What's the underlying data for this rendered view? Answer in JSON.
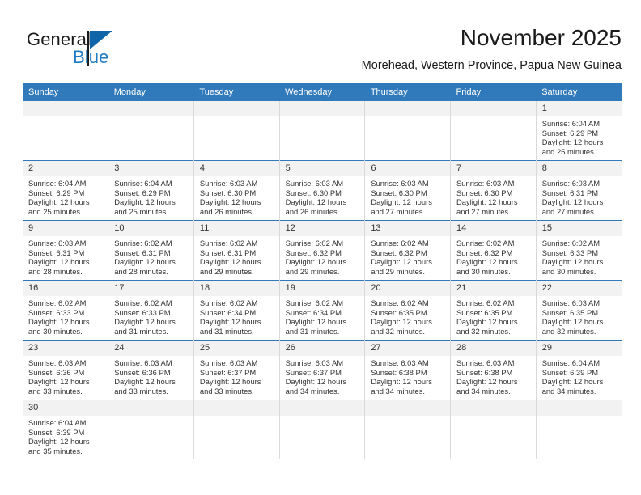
{
  "brand": {
    "name_primary": "General",
    "name_secondary": "Blue",
    "logo_icon": "blue-flag-triangle-icon",
    "primary_color": "#1a1a1a",
    "secondary_color": "#1f7bc1"
  },
  "header": {
    "title": "November 2025",
    "subtitle": "Morehead, Western Province, Papua New Guinea"
  },
  "theme": {
    "header_row_bg": "#3079ba",
    "header_row_text": "#ffffff",
    "daynum_bg": "#f2f2f2",
    "cell_bg": "#ffffff",
    "week_divider": "#3079ba",
    "column_divider": "#d9d9d9",
    "text_color": "#333333"
  },
  "weekdays": [
    "Sunday",
    "Monday",
    "Tuesday",
    "Wednesday",
    "Thursday",
    "Friday",
    "Saturday"
  ],
  "labels": {
    "sunrise_prefix": "Sunrise:",
    "sunset_prefix": "Sunset:",
    "daylight_prefix": "Daylight:"
  },
  "weeks": [
    [
      {
        "blank": true
      },
      {
        "blank": true
      },
      {
        "blank": true
      },
      {
        "blank": true
      },
      {
        "blank": true
      },
      {
        "blank": true
      },
      {
        "day": "1",
        "sunrise": "Sunrise: 6:04 AM",
        "sunset": "Sunset: 6:29 PM",
        "daylight_l1": "Daylight: 12 hours",
        "daylight_l2": "and 25 minutes."
      }
    ],
    [
      {
        "day": "2",
        "sunrise": "Sunrise: 6:04 AM",
        "sunset": "Sunset: 6:29 PM",
        "daylight_l1": "Daylight: 12 hours",
        "daylight_l2": "and 25 minutes."
      },
      {
        "day": "3",
        "sunrise": "Sunrise: 6:04 AM",
        "sunset": "Sunset: 6:29 PM",
        "daylight_l1": "Daylight: 12 hours",
        "daylight_l2": "and 25 minutes."
      },
      {
        "day": "4",
        "sunrise": "Sunrise: 6:03 AM",
        "sunset": "Sunset: 6:30 PM",
        "daylight_l1": "Daylight: 12 hours",
        "daylight_l2": "and 26 minutes."
      },
      {
        "day": "5",
        "sunrise": "Sunrise: 6:03 AM",
        "sunset": "Sunset: 6:30 PM",
        "daylight_l1": "Daylight: 12 hours",
        "daylight_l2": "and 26 minutes."
      },
      {
        "day": "6",
        "sunrise": "Sunrise: 6:03 AM",
        "sunset": "Sunset: 6:30 PM",
        "daylight_l1": "Daylight: 12 hours",
        "daylight_l2": "and 27 minutes."
      },
      {
        "day": "7",
        "sunrise": "Sunrise: 6:03 AM",
        "sunset": "Sunset: 6:30 PM",
        "daylight_l1": "Daylight: 12 hours",
        "daylight_l2": "and 27 minutes."
      },
      {
        "day": "8",
        "sunrise": "Sunrise: 6:03 AM",
        "sunset": "Sunset: 6:31 PM",
        "daylight_l1": "Daylight: 12 hours",
        "daylight_l2": "and 27 minutes."
      }
    ],
    [
      {
        "day": "9",
        "sunrise": "Sunrise: 6:03 AM",
        "sunset": "Sunset: 6:31 PM",
        "daylight_l1": "Daylight: 12 hours",
        "daylight_l2": "and 28 minutes."
      },
      {
        "day": "10",
        "sunrise": "Sunrise: 6:02 AM",
        "sunset": "Sunset: 6:31 PM",
        "daylight_l1": "Daylight: 12 hours",
        "daylight_l2": "and 28 minutes."
      },
      {
        "day": "11",
        "sunrise": "Sunrise: 6:02 AM",
        "sunset": "Sunset: 6:31 PM",
        "daylight_l1": "Daylight: 12 hours",
        "daylight_l2": "and 29 minutes."
      },
      {
        "day": "12",
        "sunrise": "Sunrise: 6:02 AM",
        "sunset": "Sunset: 6:32 PM",
        "daylight_l1": "Daylight: 12 hours",
        "daylight_l2": "and 29 minutes."
      },
      {
        "day": "13",
        "sunrise": "Sunrise: 6:02 AM",
        "sunset": "Sunset: 6:32 PM",
        "daylight_l1": "Daylight: 12 hours",
        "daylight_l2": "and 29 minutes."
      },
      {
        "day": "14",
        "sunrise": "Sunrise: 6:02 AM",
        "sunset": "Sunset: 6:32 PM",
        "daylight_l1": "Daylight: 12 hours",
        "daylight_l2": "and 30 minutes."
      },
      {
        "day": "15",
        "sunrise": "Sunrise: 6:02 AM",
        "sunset": "Sunset: 6:33 PM",
        "daylight_l1": "Daylight: 12 hours",
        "daylight_l2": "and 30 minutes."
      }
    ],
    [
      {
        "day": "16",
        "sunrise": "Sunrise: 6:02 AM",
        "sunset": "Sunset: 6:33 PM",
        "daylight_l1": "Daylight: 12 hours",
        "daylight_l2": "and 30 minutes."
      },
      {
        "day": "17",
        "sunrise": "Sunrise: 6:02 AM",
        "sunset": "Sunset: 6:33 PM",
        "daylight_l1": "Daylight: 12 hours",
        "daylight_l2": "and 31 minutes."
      },
      {
        "day": "18",
        "sunrise": "Sunrise: 6:02 AM",
        "sunset": "Sunset: 6:34 PM",
        "daylight_l1": "Daylight: 12 hours",
        "daylight_l2": "and 31 minutes."
      },
      {
        "day": "19",
        "sunrise": "Sunrise: 6:02 AM",
        "sunset": "Sunset: 6:34 PM",
        "daylight_l1": "Daylight: 12 hours",
        "daylight_l2": "and 31 minutes."
      },
      {
        "day": "20",
        "sunrise": "Sunrise: 6:02 AM",
        "sunset": "Sunset: 6:35 PM",
        "daylight_l1": "Daylight: 12 hours",
        "daylight_l2": "and 32 minutes."
      },
      {
        "day": "21",
        "sunrise": "Sunrise: 6:02 AM",
        "sunset": "Sunset: 6:35 PM",
        "daylight_l1": "Daylight: 12 hours",
        "daylight_l2": "and 32 minutes."
      },
      {
        "day": "22",
        "sunrise": "Sunrise: 6:03 AM",
        "sunset": "Sunset: 6:35 PM",
        "daylight_l1": "Daylight: 12 hours",
        "daylight_l2": "and 32 minutes."
      }
    ],
    [
      {
        "day": "23",
        "sunrise": "Sunrise: 6:03 AM",
        "sunset": "Sunset: 6:36 PM",
        "daylight_l1": "Daylight: 12 hours",
        "daylight_l2": "and 33 minutes."
      },
      {
        "day": "24",
        "sunrise": "Sunrise: 6:03 AM",
        "sunset": "Sunset: 6:36 PM",
        "daylight_l1": "Daylight: 12 hours",
        "daylight_l2": "and 33 minutes."
      },
      {
        "day": "25",
        "sunrise": "Sunrise: 6:03 AM",
        "sunset": "Sunset: 6:37 PM",
        "daylight_l1": "Daylight: 12 hours",
        "daylight_l2": "and 33 minutes."
      },
      {
        "day": "26",
        "sunrise": "Sunrise: 6:03 AM",
        "sunset": "Sunset: 6:37 PM",
        "daylight_l1": "Daylight: 12 hours",
        "daylight_l2": "and 34 minutes."
      },
      {
        "day": "27",
        "sunrise": "Sunrise: 6:03 AM",
        "sunset": "Sunset: 6:38 PM",
        "daylight_l1": "Daylight: 12 hours",
        "daylight_l2": "and 34 minutes."
      },
      {
        "day": "28",
        "sunrise": "Sunrise: 6:03 AM",
        "sunset": "Sunset: 6:38 PM",
        "daylight_l1": "Daylight: 12 hours",
        "daylight_l2": "and 34 minutes."
      },
      {
        "day": "29",
        "sunrise": "Sunrise: 6:04 AM",
        "sunset": "Sunset: 6:39 PM",
        "daylight_l1": "Daylight: 12 hours",
        "daylight_l2": "and 34 minutes."
      }
    ],
    [
      {
        "day": "30",
        "sunrise": "Sunrise: 6:04 AM",
        "sunset": "Sunset: 6:39 PM",
        "daylight_l1": "Daylight: 12 hours",
        "daylight_l2": "and 35 minutes."
      },
      {
        "blank": true
      },
      {
        "blank": true
      },
      {
        "blank": true
      },
      {
        "blank": true
      },
      {
        "blank": true
      },
      {
        "blank": true
      }
    ]
  ]
}
